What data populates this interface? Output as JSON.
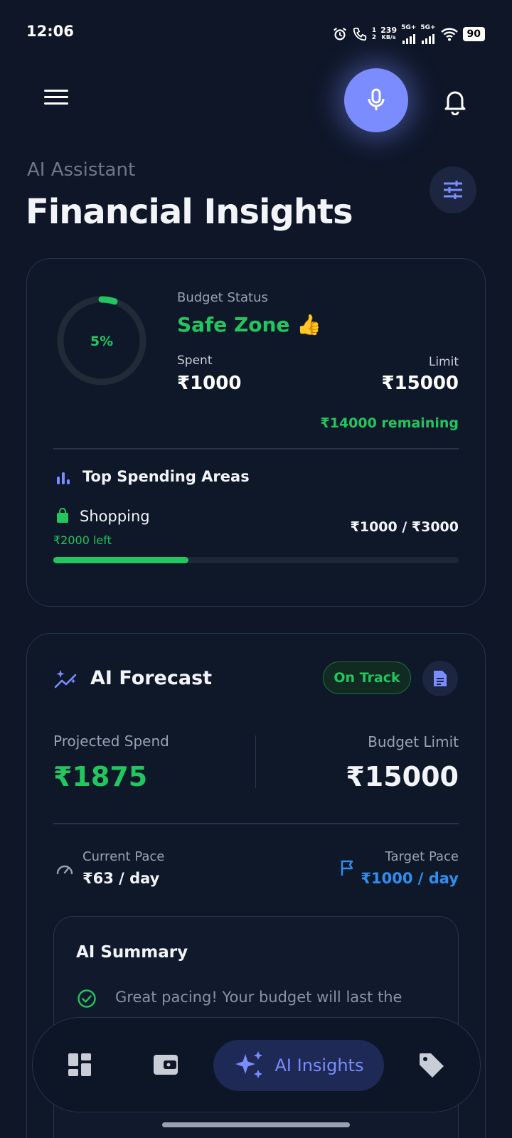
{
  "status_bar": {
    "time": "12:06",
    "sim_label_top": "1",
    "sim_label_bottom": "2",
    "speed_value": "239",
    "speed_unit": "KB/s",
    "net1": "5G+",
    "net2": "5G+",
    "battery": "90"
  },
  "header": {
    "subtitle": "AI Assistant",
    "title": "Financial Insights"
  },
  "budget_card": {
    "ring_percent_label": "5%",
    "ring_percent": 5,
    "status_label": "Budget Status",
    "status_value": "Safe Zone 👍",
    "spent_label": "Spent",
    "spent_value": "₹1000",
    "limit_label": "Limit",
    "limit_value": "₹15000",
    "remaining": "₹14000 remaining",
    "top_spending_title": "Top Spending Areas",
    "category": {
      "name": "Shopping",
      "left": "₹2000 left",
      "amount": "₹1000 / ₹3000",
      "progress_fraction": 0.333
    }
  },
  "forecast_card": {
    "title": "AI Forecast",
    "badge": "On Track",
    "projected_label": "Projected Spend",
    "projected_value": "₹1875",
    "budget_limit_label": "Budget Limit",
    "budget_limit_value": "₹15000",
    "current_pace_label": "Current Pace",
    "current_pace_value": "₹63 / day",
    "target_pace_label": "Target Pace",
    "target_pace_value": "₹1000 / day",
    "summary_title": "AI Summary",
    "summary_text": "Great pacing! Your budget will last the"
  },
  "bottom_nav": {
    "active_label": "AI Insights",
    "items": [
      "dashboard-icon",
      "wallet-icon",
      "sparkles-icon",
      "tag-icon"
    ]
  },
  "colors": {
    "background": "#0e1628",
    "accent": "#7b8cff",
    "success": "#22c55e",
    "info": "#2f8ff0"
  }
}
